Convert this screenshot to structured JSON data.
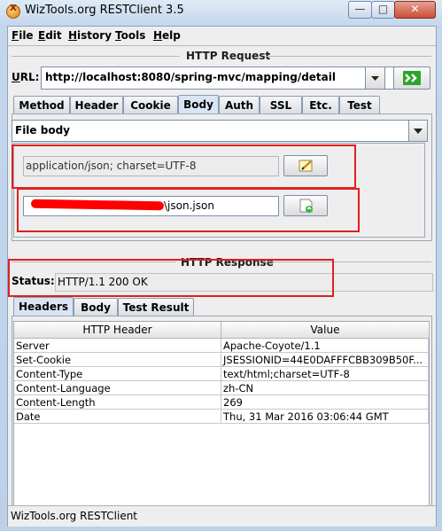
{
  "window": {
    "title": "WizTools.org RESTClient 3.5",
    "app_icon_glyph": "X",
    "min_glyph": "—",
    "max_glyph": "□",
    "close_glyph": "✕"
  },
  "menu": {
    "items": [
      {
        "key": "F",
        "rest": "ile"
      },
      {
        "key": "E",
        "rest": "dit"
      },
      {
        "key": "H",
        "rest": "istory"
      },
      {
        "key": "T",
        "rest": "ools"
      },
      {
        "key": "H",
        "rest": "elp"
      }
    ]
  },
  "request": {
    "section_title": "HTTP Request",
    "url_label": "URL:",
    "url_value": "http://localhost:8080/spring-mvc/mapping/detail",
    "tabs": [
      "Method",
      "Header",
      "Cookie",
      "Body",
      "Auth",
      "SSL",
      "Etc.",
      "Test"
    ],
    "selected_tab": "Body",
    "body_type": "File body",
    "content_type": "application/json; charset=UTF-8",
    "file_path_suffix": "json.json"
  },
  "response": {
    "section_title": "HTTP Response",
    "status_label": "Status:",
    "status_value": "HTTP/1.1 200 OK",
    "tabs": [
      "Headers",
      "Body",
      "Test Result"
    ],
    "selected_tab": "Headers",
    "columns": [
      "HTTP Header",
      "Value"
    ],
    "rows": [
      [
        "Server",
        "Apache-Coyote/1.1"
      ],
      [
        "Set-Cookie",
        "JSESSIONID=44E0DAFFFCBB309B50F..."
      ],
      [
        "Content-Type",
        "text/html;charset=UTF-8"
      ],
      [
        "Content-Language",
        "zh-CN"
      ],
      [
        "Content-Length",
        "269"
      ],
      [
        "Date",
        "Thu, 31 Mar 2016 03:06:44 GMT"
      ]
    ]
  },
  "statusbar": {
    "text": "WizTools.org RESTClient"
  },
  "colors": {
    "highlight_box": "#e02020",
    "go_arrow": "#2aa52a",
    "redaction": "#ff0000"
  }
}
